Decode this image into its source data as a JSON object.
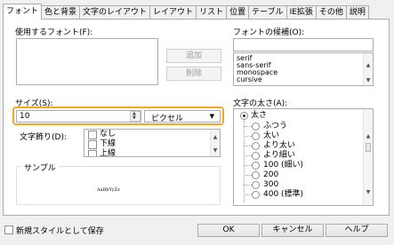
{
  "tabs": [
    {
      "label": "フォント",
      "active": true
    },
    {
      "label": "色と背景",
      "active": false
    },
    {
      "label": "文字のレイアウト",
      "active": false
    },
    {
      "label": "レイアウト",
      "active": false
    },
    {
      "label": "リスト",
      "active": false
    },
    {
      "label": "位置",
      "active": false
    },
    {
      "label": "テーブル",
      "active": false
    },
    {
      "label": "IE拡張",
      "active": false
    },
    {
      "label": "その他",
      "active": false
    },
    {
      "label": "説明",
      "active": false
    }
  ],
  "font": {
    "used_label": "使用するフォント(F):",
    "candidates_label": "フォントの候補(O):",
    "candidate_input_value": "",
    "add_button": "追加",
    "remove_button": "削除",
    "generic_fonts": [
      "serif",
      "sans-serif",
      "monospace",
      "cursive"
    ]
  },
  "size": {
    "label": "サイズ(S):",
    "value": "10",
    "unit": "ピクセル"
  },
  "decoration": {
    "label": "文字飾り(D):",
    "options": [
      "なし",
      "下線",
      "上線"
    ]
  },
  "weight": {
    "label": "文字の太さ(A):",
    "root": "太さ",
    "options": [
      "ふつう",
      "太い",
      "より太い",
      "より細い",
      "100 (細い)",
      "200",
      "300",
      "400 (標準)"
    ]
  },
  "sample": {
    "label": "サンプル",
    "text": "AaBbYyZz"
  },
  "footer": {
    "save_label": "新規スタイルとして保存",
    "ok": "OK",
    "cancel": "キャンセル",
    "help": "ヘルプ"
  },
  "colors": {
    "focus": "#f5a623"
  }
}
